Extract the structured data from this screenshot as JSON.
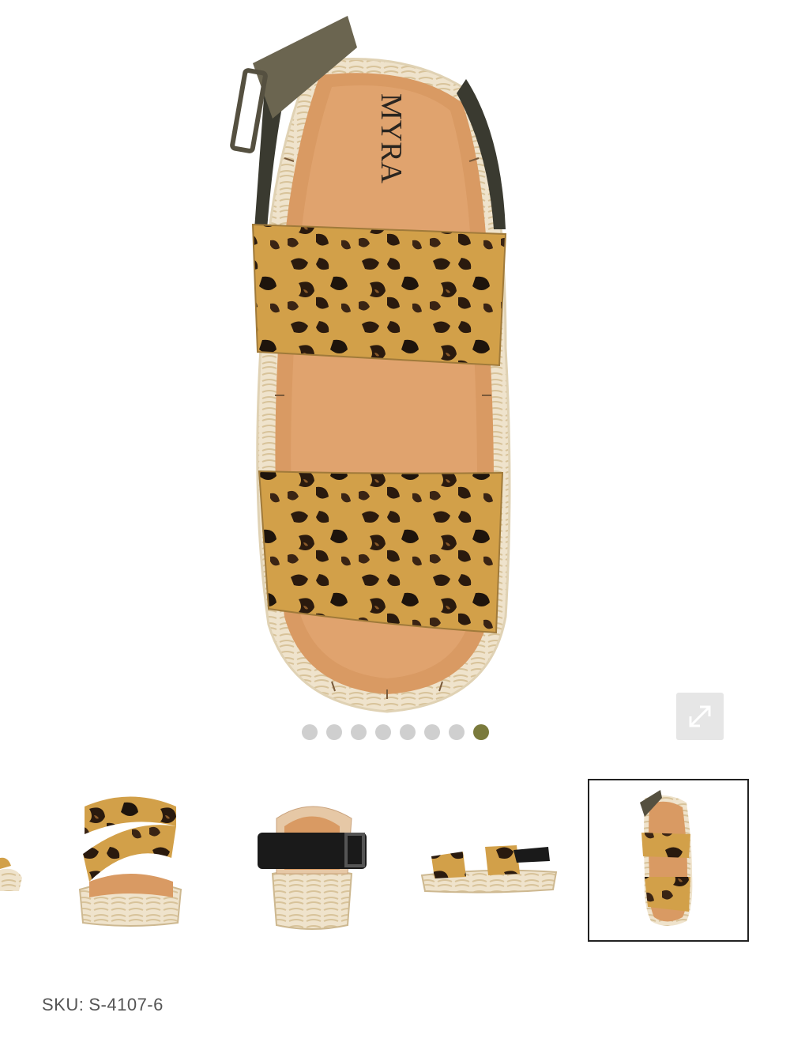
{
  "product": {
    "brand_on_insole": "MYRA",
    "sku_label": "SKU:",
    "sku_value": "S-4107-6"
  },
  "gallery": {
    "image_count": 8,
    "active_index": 7,
    "dot_color": "#cfcfcf",
    "active_dot_color": "#7a7a3c",
    "expand_icon": "expand-arrows-icon"
  },
  "thumbnails": [
    {
      "name": "thumbnail-partial-left",
      "selected": false
    },
    {
      "name": "thumbnail-front-view",
      "selected": false
    },
    {
      "name": "thumbnail-back-view",
      "selected": false
    },
    {
      "name": "thumbnail-side-view",
      "selected": false
    },
    {
      "name": "thumbnail-top-view",
      "selected": true
    }
  ]
}
